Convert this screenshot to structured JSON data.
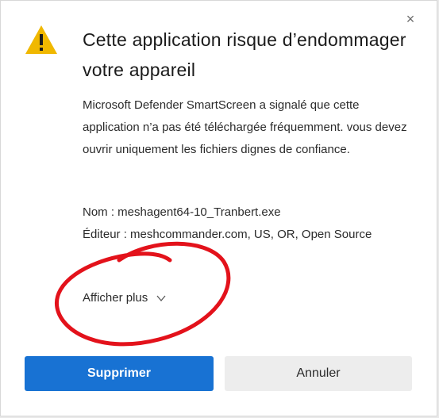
{
  "dialog": {
    "close_glyph": "×",
    "title": "Cette application risque d’endommager votre appareil",
    "body": "Microsoft Defender SmartScreen a signalé que cette application n’a pas été téléchargée fréquemment. vous devez ouvrir uniquement les fichiers dignes de confiance.",
    "name_line": "Nom : meshagent64-10_Tranbert.exe",
    "publisher_line": "Éditeur : meshcommander.com, US, OR, Open Source",
    "show_more": "Afficher plus",
    "delete_label": "Supprimer",
    "cancel_label": "Annuler"
  },
  "colors": {
    "warning": "#f0b800",
    "primary": "#1872d3",
    "annotation": "#e3121b"
  },
  "icons": {
    "warning": "warning-triangle-icon",
    "close": "close-icon",
    "chevron": "chevron-down-icon"
  }
}
